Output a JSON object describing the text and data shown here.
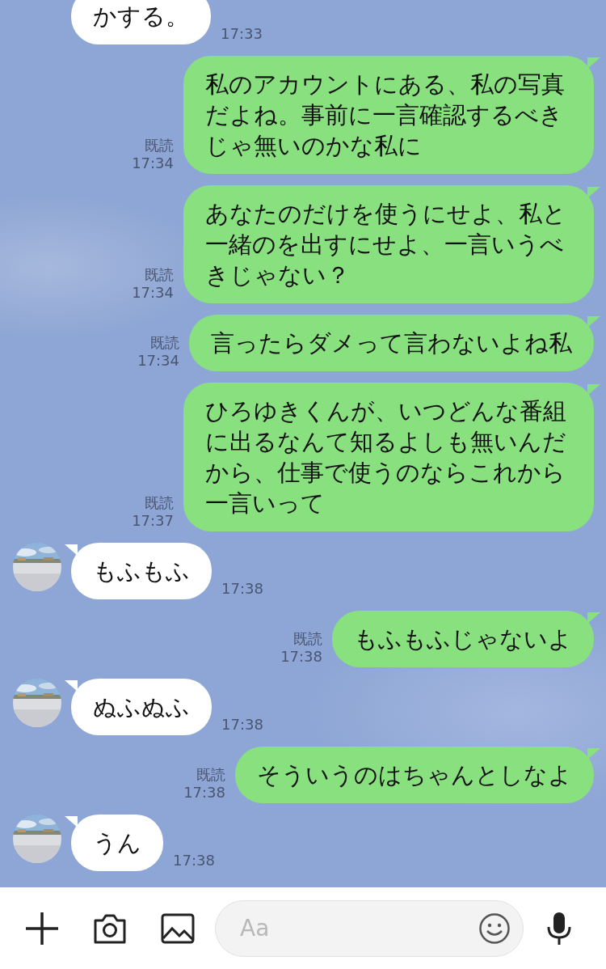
{
  "messages": [
    {
      "kind": "incoming",
      "avatar": false,
      "text": "かする。",
      "time": "17:33"
    },
    {
      "kind": "outgoing",
      "read_label": "既読",
      "text": "私のアカウントにある、私の写真だよね。事前に一言確認するべきじゃ無いのかな私に",
      "time": "17:34"
    },
    {
      "kind": "outgoing",
      "read_label": "既読",
      "text": "あなたのだけを使うにせよ、私と一緒のを出すにせよ、一言いうべきじゃない？",
      "time": "17:34"
    },
    {
      "kind": "outgoing",
      "read_label": "既読",
      "text": "言ったらダメって言わないよね私",
      "time": "17:34"
    },
    {
      "kind": "outgoing",
      "read_label": "既読",
      "text": "ひろゆきくんが、いつどんな番組に出るなんて知るよしも無いんだから、仕事で使うのならこれから一言いって",
      "time": "17:37"
    },
    {
      "kind": "incoming",
      "avatar": true,
      "text": "もふもふ",
      "time": "17:38"
    },
    {
      "kind": "outgoing",
      "read_label": "既読",
      "text": "もふもふじゃないよ",
      "time": "17:38"
    },
    {
      "kind": "incoming",
      "avatar": true,
      "text": "ぬふぬふ",
      "time": "17:38"
    },
    {
      "kind": "outgoing",
      "read_label": "既読",
      "text": "そういうのはちゃんとしなよ",
      "time": "17:38"
    },
    {
      "kind": "incoming",
      "avatar": true,
      "text": "うん",
      "time": "17:38"
    }
  ],
  "composer": {
    "placeholder": "Aa"
  }
}
